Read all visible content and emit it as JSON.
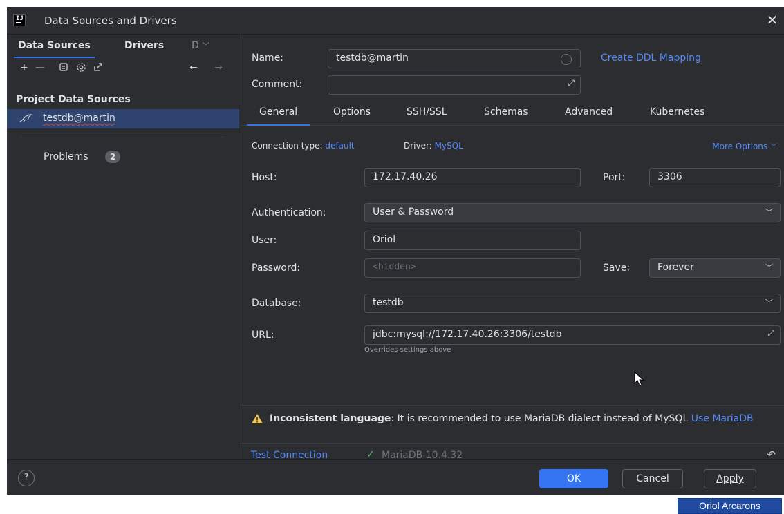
{
  "window": {
    "title": "Data Sources and Drivers"
  },
  "sidebar": {
    "tabs": [
      {
        "label": "Data Sources"
      },
      {
        "label": "Drivers"
      },
      {
        "label": "D"
      }
    ],
    "section_title": "Project Data Sources",
    "items": [
      {
        "label": "testdb@martin"
      }
    ],
    "problems": {
      "label": "Problems",
      "count": "2"
    }
  },
  "form": {
    "name_label": "Name:",
    "name_value": "testdb@martin",
    "create_ddl": "Create DDL Mapping",
    "comment_label": "Comment:",
    "comment_value": ""
  },
  "tabs": [
    {
      "label": "General"
    },
    {
      "label": "Options"
    },
    {
      "label": "SSH/SSL"
    },
    {
      "label": "Schemas"
    },
    {
      "label": "Advanced"
    },
    {
      "label": "Kubernetes"
    }
  ],
  "general": {
    "connection_type_label": "Connection type:",
    "connection_type_value": "default",
    "driver_label": "Driver:",
    "driver_value": "MySQL",
    "more_options": "More Options",
    "host_label": "Host:",
    "host_value": "172.17.40.26",
    "port_label": "Port:",
    "port_value": "3306",
    "auth_label": "Authentication:",
    "auth_value": "User & Password",
    "user_label": "User:",
    "user_value": "Oriol",
    "password_label": "Password:",
    "password_placeholder": "<hidden>",
    "save_label": "Save:",
    "save_value": "Forever",
    "database_label": "Database:",
    "database_value": "testdb",
    "url_label": "URL:",
    "url_value": "jdbc:mysql://172.17.40.26:3306/testdb",
    "url_hint": "Overrides settings above"
  },
  "warning": {
    "title": "Inconsistent language",
    "text": ": It is recommended to use MariaDB dialect instead of MySQL",
    "action": "Use MariaDB"
  },
  "test": {
    "label": "Test Connection",
    "version": "MariaDB 10.4.32"
  },
  "footer": {
    "help": "?",
    "ok": "OK",
    "cancel": "Cancel",
    "apply": "Apply"
  },
  "user_tag": "Oriol Arcarons",
  "colors": {
    "background": "#2b2d30",
    "accent": "#3574f0",
    "link": "#548af7",
    "selection": "#2e436e",
    "success": "#5fb865",
    "warning": "#f2c55c"
  }
}
